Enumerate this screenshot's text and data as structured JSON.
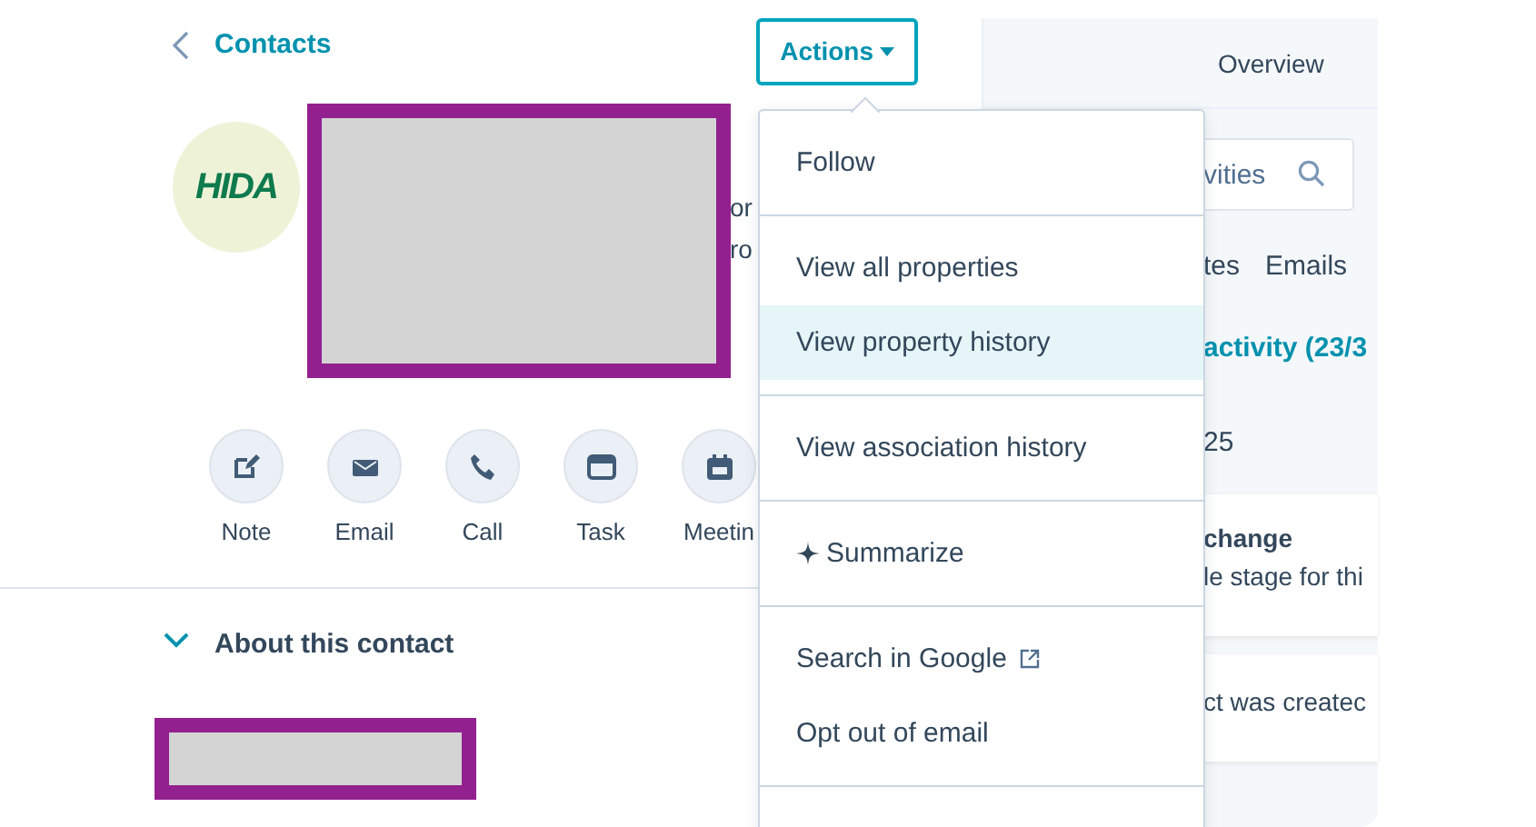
{
  "back_link": {
    "label": "Contacts"
  },
  "actions_button": {
    "label": "Actions"
  },
  "profile": {
    "avatar_logo": "HIDA",
    "cut_texts": [
      "or",
      "ro"
    ]
  },
  "quick_actions": [
    {
      "label": "Note",
      "kind": "note"
    },
    {
      "label": "Email",
      "kind": "email"
    },
    {
      "label": "Call",
      "kind": "call"
    },
    {
      "label": "Task",
      "kind": "task"
    },
    {
      "label": "Meetin",
      "kind": "meeting"
    }
  ],
  "about": {
    "title": "About this contact",
    "expanded": true
  },
  "menu": {
    "sections": [
      [
        {
          "label": "Follow",
          "kind": "plain",
          "selected": false
        }
      ],
      [
        {
          "label": "View all properties",
          "kind": "plain",
          "selected": false
        },
        {
          "label": "View property history",
          "kind": "plain",
          "selected": true
        }
      ],
      [
        {
          "label": "View association history",
          "kind": "plain",
          "selected": false
        }
      ],
      [
        {
          "label": "Summarize",
          "kind": "ai",
          "selected": false
        }
      ],
      [
        {
          "label": "Search in Google",
          "kind": "external",
          "selected": false
        },
        {
          "label": "Opt out of email",
          "kind": "plain",
          "selected": false
        }
      ]
    ]
  },
  "right_panel": {
    "tab": "Overview",
    "search": {
      "placeholder": "vities"
    },
    "tabs": [
      "tes",
      "Emails"
    ],
    "heading": "activity (23/3",
    "date": "25",
    "cards": [
      {
        "title": "change",
        "text": "le stage for thi"
      },
      {
        "text": "ct was createc"
      }
    ]
  }
}
